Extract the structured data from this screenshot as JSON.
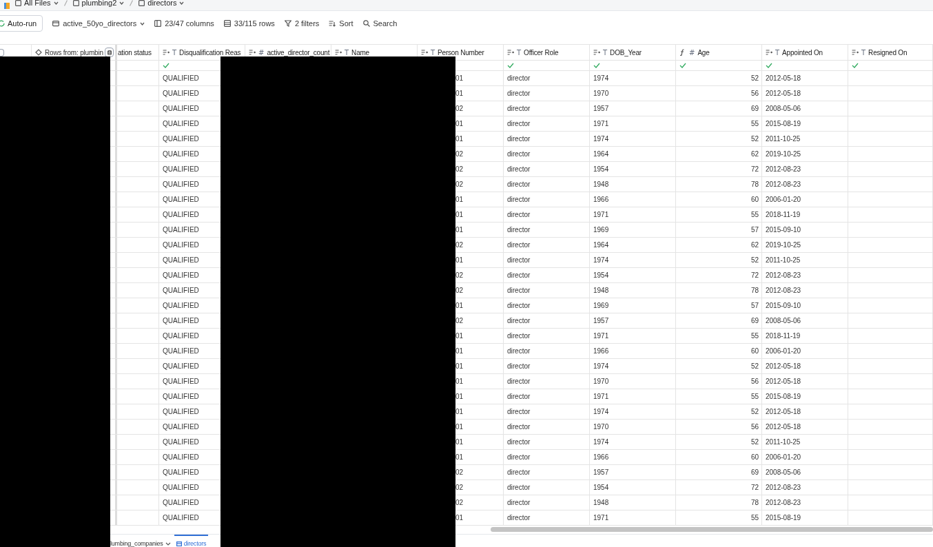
{
  "breadcrumb": [
    "All Files",
    "plumbing2",
    "directors"
  ],
  "toolbar": {
    "autorun": "Auto-run",
    "view": "active_50yo_directors",
    "columns": "23/47 columns",
    "rows": "33/115 rows",
    "filters": "2 filters",
    "sort": "Sort",
    "search": "Search"
  },
  "columns": [
    {
      "label": "Rows from: plumbin",
      "kind": "source",
      "check": false
    },
    {
      "label": "ation status",
      "kind": "plain",
      "check": false
    },
    {
      "label": "Disqualification Reas",
      "kind": "sorted",
      "type_glyph": "T",
      "check": true
    },
    {
      "label": "active_director_count",
      "kind": "sorted",
      "type_glyph": "#",
      "check": false
    },
    {
      "label": "Name",
      "kind": "sorted",
      "type_glyph": "T",
      "check": false
    },
    {
      "label": "Person Number",
      "kind": "sorted",
      "type_glyph": "T",
      "check": false
    },
    {
      "label": "Officer Role",
      "kind": "sorted",
      "type_glyph": "T",
      "check": true
    },
    {
      "label": "DOB_Year",
      "kind": "sorted",
      "type_glyph": "T",
      "check": true
    },
    {
      "label": "Age",
      "kind": "formula",
      "type_glyph": "#",
      "check": true
    },
    {
      "label": "Appointed On",
      "kind": "sorted",
      "type_glyph": "T",
      "check": true
    },
    {
      "label": "Resigned On",
      "kind": "sorted",
      "type_glyph": "T",
      "check": true
    }
  ],
  "select_all_checked": false,
  "rows": [
    {
      "reason": "QUALIFIED",
      "person_number": "01",
      "role": "director",
      "dob_year": "1974",
      "age": "52",
      "appointed_on": "2012-05-18"
    },
    {
      "reason": "QUALIFIED",
      "person_number": "01",
      "role": "director",
      "dob_year": "1970",
      "age": "56",
      "appointed_on": "2012-05-18"
    },
    {
      "reason": "QUALIFIED",
      "person_number": "02",
      "role": "director",
      "dob_year": "1957",
      "age": "69",
      "appointed_on": "2008-05-06"
    },
    {
      "reason": "QUALIFIED",
      "person_number": "01",
      "role": "director",
      "dob_year": "1971",
      "age": "55",
      "appointed_on": "2015-08-19"
    },
    {
      "reason": "QUALIFIED",
      "person_number": "01",
      "role": "director",
      "dob_year": "1974",
      "age": "52",
      "appointed_on": "2011-10-25"
    },
    {
      "reason": "QUALIFIED",
      "person_number": "02",
      "role": "director",
      "dob_year": "1964",
      "age": "62",
      "appointed_on": "2019-10-25"
    },
    {
      "reason": "QUALIFIED",
      "person_number": "02",
      "role": "director",
      "dob_year": "1954",
      "age": "72",
      "appointed_on": "2012-08-23"
    },
    {
      "reason": "QUALIFIED",
      "person_number": "02",
      "role": "director",
      "dob_year": "1948",
      "age": "78",
      "appointed_on": "2012-08-23"
    },
    {
      "reason": "QUALIFIED",
      "person_number": "01",
      "role": "director",
      "dob_year": "1966",
      "age": "60",
      "appointed_on": "2006-01-20"
    },
    {
      "reason": "QUALIFIED",
      "person_number": "01",
      "role": "director",
      "dob_year": "1971",
      "age": "55",
      "appointed_on": "2018-11-19"
    },
    {
      "reason": "QUALIFIED",
      "person_number": "01",
      "role": "director",
      "dob_year": "1969",
      "age": "57",
      "appointed_on": "2015-09-10"
    },
    {
      "reason": "QUALIFIED",
      "person_number": "02",
      "role": "director",
      "dob_year": "1964",
      "age": "62",
      "appointed_on": "2019-10-25"
    },
    {
      "reason": "QUALIFIED",
      "person_number": "01",
      "role": "director",
      "dob_year": "1974",
      "age": "52",
      "appointed_on": "2011-10-25"
    },
    {
      "reason": "QUALIFIED",
      "person_number": "02",
      "role": "director",
      "dob_year": "1954",
      "age": "72",
      "appointed_on": "2012-08-23"
    },
    {
      "reason": "QUALIFIED",
      "person_number": "02",
      "role": "director",
      "dob_year": "1948",
      "age": "78",
      "appointed_on": "2012-08-23"
    },
    {
      "reason": "QUALIFIED",
      "person_number": "01",
      "role": "director",
      "dob_year": "1969",
      "age": "57",
      "appointed_on": "2015-09-10"
    },
    {
      "reason": "QUALIFIED",
      "person_number": "02",
      "role": "director",
      "dob_year": "1957",
      "age": "69",
      "appointed_on": "2008-05-06"
    },
    {
      "reason": "QUALIFIED",
      "person_number": "01",
      "role": "director",
      "dob_year": "1971",
      "age": "55",
      "appointed_on": "2018-11-19"
    },
    {
      "reason": "QUALIFIED",
      "person_number": "01",
      "role": "director",
      "dob_year": "1966",
      "age": "60",
      "appointed_on": "2006-01-20"
    },
    {
      "reason": "QUALIFIED",
      "person_number": "01",
      "role": "director",
      "dob_year": "1974",
      "age": "52",
      "appointed_on": "2012-05-18"
    },
    {
      "reason": "QUALIFIED",
      "person_number": "01",
      "role": "director",
      "dob_year": "1970",
      "age": "56",
      "appointed_on": "2012-05-18"
    },
    {
      "reason": "QUALIFIED",
      "person_number": "01",
      "role": "director",
      "dob_year": "1971",
      "age": "55",
      "appointed_on": "2015-08-19"
    },
    {
      "reason": "QUALIFIED",
      "person_number": "01",
      "role": "director",
      "dob_year": "1974",
      "age": "52",
      "appointed_on": "2012-05-18"
    },
    {
      "reason": "QUALIFIED",
      "person_number": "01",
      "role": "director",
      "dob_year": "1970",
      "age": "56",
      "appointed_on": "2012-05-18"
    },
    {
      "reason": "QUALIFIED",
      "person_number": "01",
      "role": "director",
      "dob_year": "1974",
      "age": "52",
      "appointed_on": "2011-10-25"
    },
    {
      "reason": "QUALIFIED",
      "person_number": "01",
      "role": "director",
      "dob_year": "1966",
      "age": "60",
      "appointed_on": "2006-01-20"
    },
    {
      "reason": "QUALIFIED",
      "person_number": "02",
      "role": "director",
      "dob_year": "1957",
      "age": "69",
      "appointed_on": "2008-05-06"
    },
    {
      "reason": "QUALIFIED",
      "person_number": "02",
      "role": "director",
      "dob_year": "1954",
      "age": "72",
      "appointed_on": "2012-08-23"
    },
    {
      "reason": "QUALIFIED",
      "person_number": "02",
      "role": "director",
      "dob_year": "1948",
      "age": "78",
      "appointed_on": "2012-08-23"
    },
    {
      "reason": "QUALIFIED",
      "person_number": "01",
      "role": "director",
      "dob_year": "1971",
      "age": "55",
      "appointed_on": "2015-08-19"
    }
  ],
  "sheet_tabs": [
    {
      "label": "lumbing_companies",
      "selected": false,
      "menu": true
    },
    {
      "label": "directors",
      "selected": true,
      "menu": false
    }
  ]
}
